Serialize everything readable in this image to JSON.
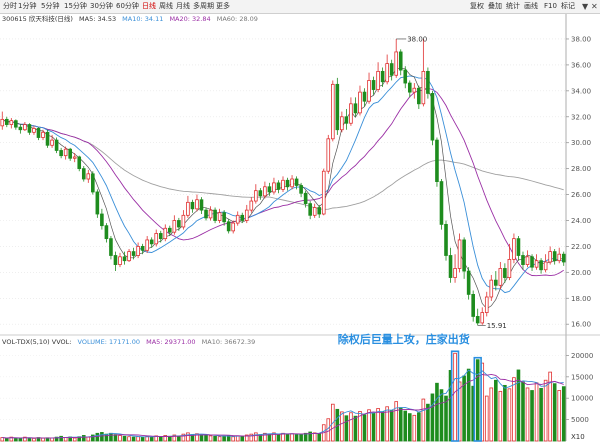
{
  "toolbar": {
    "left_items": [
      "分时",
      "1分钟",
      "5分钟",
      "15分钟",
      "30分钟",
      "60分钟",
      "日线",
      "周线",
      "月线",
      "多周期",
      "更多"
    ],
    "active_index": 6,
    "right_items": [
      "复权",
      "叠加",
      "统计",
      "画线",
      "F10",
      "标记"
    ]
  },
  "main_legend": {
    "stock": "300615 欣天科技(日线)",
    "ma5": "MA5: 34.53",
    "ma10": "MA10: 34.11",
    "ma20": "MA20: 32.84",
    "ma60": "MA60: 28.09"
  },
  "vol_legend": {
    "indicator": "VOL-TDX(5,10) VVOL:",
    "volume": "VOLUME: 17171.00",
    "ma5": "MA5: 29371.00",
    "ma10": "MA10: 36672.39"
  },
  "annotation_text": "除权后巨量上攻，庄家出货",
  "scale_badge": "X10",
  "colors": {
    "up": "#e03030",
    "down": "#1e8c1e",
    "ma5": "#3a8fd8",
    "ma10": "#9b2fa5",
    "ma20": "#7a7a7a",
    "ma60": "#a0a0a0",
    "highlight": "#2a8fe0"
  },
  "chart_data": {
    "type": "candlestick",
    "price_axis": {
      "ylim": [
        15.4,
        39.0
      ],
      "ticks": [
        16.0,
        18.0,
        20.0,
        22.0,
        24.0,
        26.0,
        28.0,
        30.0,
        32.0,
        34.0,
        36.0,
        38.0
      ]
    },
    "volume_axis": {
      "ylim": [
        0,
        21500
      ],
      "ticks": [
        5000,
        10000,
        15000,
        20000
      ]
    },
    "annotations": {
      "high": "38.00",
      "low": "15.91"
    },
    "candles": [
      [
        31.3,
        31.8,
        31.0,
        32.4
      ],
      [
        31.8,
        31.4,
        31.2,
        32.0
      ],
      [
        31.4,
        31.7,
        31.1,
        31.9
      ],
      [
        31.7,
        31.2,
        31.0,
        31.8
      ],
      [
        31.2,
        31.0,
        30.7,
        31.4
      ],
      [
        31.0,
        31.4,
        30.9,
        31.6
      ],
      [
        31.4,
        30.8,
        30.6,
        31.5
      ],
      [
        30.8,
        31.1,
        30.6,
        31.3
      ],
      [
        31.1,
        30.4,
        30.2,
        31.2
      ],
      [
        30.4,
        30.8,
        30.2,
        31.0
      ],
      [
        30.8,
        29.8,
        29.6,
        31.0
      ],
      [
        29.8,
        30.2,
        29.6,
        30.6
      ],
      [
        30.2,
        29.4,
        29.2,
        30.4
      ],
      [
        29.4,
        29.0,
        28.8,
        29.6
      ],
      [
        29.0,
        29.5,
        28.7,
        29.7
      ],
      [
        29.5,
        28.8,
        28.6,
        29.6
      ],
      [
        28.8,
        28.9,
        28.5,
        29.2
      ],
      [
        28.9,
        28.0,
        27.8,
        29.0
      ],
      [
        28.0,
        27.2,
        27.0,
        28.2
      ],
      [
        27.2,
        27.6,
        26.9,
        27.9
      ],
      [
        27.6,
        26.2,
        26.0,
        27.8
      ],
      [
        26.2,
        24.5,
        24.2,
        26.4
      ],
      [
        24.5,
        23.6,
        23.3,
        24.9
      ],
      [
        23.6,
        22.6,
        22.3,
        23.8
      ],
      [
        22.6,
        21.3,
        21.0,
        22.8
      ],
      [
        21.3,
        20.6,
        20.1,
        21.6
      ],
      [
        20.6,
        21.2,
        20.4,
        21.5
      ],
      [
        21.2,
        20.9,
        20.6,
        21.6
      ],
      [
        20.9,
        21.6,
        20.8,
        21.8
      ],
      [
        21.6,
        21.3,
        21.0,
        21.9
      ],
      [
        21.3,
        22.0,
        21.1,
        22.3
      ],
      [
        22.0,
        21.7,
        21.4,
        22.2
      ],
      [
        21.7,
        22.5,
        21.5,
        22.8
      ],
      [
        22.5,
        22.2,
        21.9,
        22.7
      ],
      [
        22.2,
        23.0,
        22.0,
        23.3
      ],
      [
        23.0,
        22.6,
        22.3,
        23.2
      ],
      [
        22.6,
        23.4,
        22.4,
        23.7
      ],
      [
        23.4,
        23.1,
        22.8,
        23.6
      ],
      [
        23.1,
        24.0,
        22.9,
        24.4
      ],
      [
        24.0,
        23.5,
        23.2,
        24.2
      ],
      [
        23.5,
        24.4,
        23.3,
        24.8
      ],
      [
        24.4,
        25.4,
        24.2,
        25.9
      ],
      [
        25.4,
        24.9,
        24.6,
        25.6
      ],
      [
        24.9,
        25.6,
        24.7,
        26.0
      ],
      [
        25.6,
        24.8,
        24.5,
        25.8
      ],
      [
        24.8,
        24.2,
        24.0,
        25.0
      ],
      [
        24.2,
        24.8,
        24.0,
        25.1
      ],
      [
        24.8,
        24.0,
        23.8,
        25.0
      ],
      [
        24.0,
        24.6,
        23.8,
        24.9
      ],
      [
        24.6,
        23.9,
        23.6,
        24.8
      ],
      [
        23.9,
        23.2,
        23.0,
        24.1
      ],
      [
        23.2,
        23.8,
        23.0,
        24.0
      ],
      [
        23.8,
        24.4,
        23.6,
        24.7
      ],
      [
        24.4,
        24.0,
        23.8,
        24.6
      ],
      [
        24.0,
        24.8,
        23.8,
        25.2
      ],
      [
        24.8,
        25.5,
        24.6,
        25.8
      ],
      [
        25.5,
        26.3,
        25.3,
        26.8
      ],
      [
        26.3,
        25.9,
        25.6,
        26.5
      ],
      [
        25.9,
        26.6,
        25.7,
        27.0
      ],
      [
        26.6,
        26.2,
        25.9,
        26.9
      ],
      [
        26.2,
        26.9,
        26.0,
        27.3
      ],
      [
        26.9,
        26.4,
        26.1,
        27.1
      ],
      [
        26.4,
        27.1,
        26.2,
        27.4
      ],
      [
        27.1,
        26.6,
        26.3,
        27.3
      ],
      [
        26.6,
        27.2,
        26.4,
        27.5
      ],
      [
        27.2,
        26.7,
        26.4,
        27.4
      ],
      [
        26.7,
        26.1,
        25.8,
        26.9
      ],
      [
        26.1,
        25.3,
        25.0,
        26.3
      ],
      [
        25.3,
        24.4,
        24.1,
        25.5
      ],
      [
        24.4,
        25.0,
        24.2,
        25.3
      ],
      [
        25.0,
        24.5,
        24.2,
        25.2
      ],
      [
        24.5,
        27.8,
        24.4,
        28.0
      ],
      [
        27.8,
        30.3,
        27.6,
        30.6
      ],
      [
        30.3,
        34.5,
        30.1,
        34.8
      ],
      [
        34.5,
        31.0,
        30.6,
        35.0
      ],
      [
        31.0,
        32.0,
        30.8,
        32.4
      ],
      [
        32.0,
        31.5,
        31.0,
        32.6
      ],
      [
        31.5,
        33.0,
        31.3,
        33.5
      ],
      [
        33.0,
        32.3,
        32.0,
        33.5
      ],
      [
        32.3,
        33.9,
        32.1,
        34.4
      ],
      [
        33.9,
        33.2,
        32.8,
        34.2
      ],
      [
        33.2,
        34.8,
        33.0,
        35.4
      ],
      [
        34.8,
        34.1,
        33.7,
        35.1
      ],
      [
        34.1,
        35.5,
        33.9,
        36.2
      ],
      [
        35.5,
        34.7,
        34.3,
        35.8
      ],
      [
        34.7,
        36.1,
        34.5,
        36.8
      ],
      [
        36.1,
        35.2,
        34.8,
        36.4
      ],
      [
        35.2,
        37.0,
        35.0,
        38.0
      ],
      [
        37.0,
        35.6,
        35.2,
        37.2
      ],
      [
        35.6,
        34.6,
        34.2,
        35.9
      ],
      [
        34.6,
        33.9,
        33.5,
        34.8
      ],
      [
        33.9,
        34.2,
        33.4,
        34.6
      ],
      [
        34.2,
        33.0,
        32.6,
        34.4
      ],
      [
        33.0,
        35.5,
        32.8,
        38.0
      ],
      [
        35.5,
        33.8,
        33.4,
        35.8
      ],
      [
        33.8,
        30.2,
        29.8,
        34.0
      ],
      [
        30.2,
        27.0,
        26.6,
        30.4
      ],
      [
        27.0,
        23.7,
        23.3,
        27.2
      ],
      [
        23.7,
        21.3,
        20.9,
        24.0
      ],
      [
        21.3,
        19.6,
        19.2,
        21.9
      ],
      [
        19.6,
        20.3,
        19.2,
        21.4
      ],
      [
        20.3,
        22.5,
        20.0,
        23.0
      ],
      [
        22.5,
        20.1,
        19.5,
        22.7
      ],
      [
        20.1,
        18.3,
        17.9,
        20.4
      ],
      [
        18.3,
        16.6,
        16.2,
        18.6
      ],
      [
        16.6,
        16.1,
        15.91,
        17.2
      ],
      [
        16.1,
        16.9,
        15.95,
        17.3
      ],
      [
        16.9,
        18.1,
        16.6,
        18.5
      ],
      [
        18.1,
        19.4,
        17.8,
        19.8
      ],
      [
        19.4,
        19.0,
        18.6,
        20.1
      ],
      [
        19.0,
        20.3,
        18.7,
        20.8
      ],
      [
        20.3,
        19.6,
        19.2,
        20.7
      ],
      [
        19.6,
        21.0,
        19.4,
        22.2
      ],
      [
        21.0,
        22.6,
        20.7,
        23.0
      ],
      [
        22.6,
        21.3,
        20.9,
        22.8
      ],
      [
        21.3,
        20.6,
        20.2,
        21.6
      ],
      [
        20.6,
        21.2,
        20.4,
        21.7
      ],
      [
        21.2,
        20.4,
        20.1,
        21.4
      ],
      [
        20.4,
        20.9,
        20.2,
        21.4
      ],
      [
        20.9,
        20.2,
        19.9,
        21.1
      ],
      [
        20.2,
        20.8,
        20.0,
        21.4
      ],
      [
        20.8,
        21.6,
        20.6,
        22.0
      ],
      [
        21.6,
        20.9,
        20.6,
        21.8
      ],
      [
        20.9,
        21.4,
        20.7,
        21.9
      ],
      [
        21.4,
        20.8,
        20.5,
        21.6
      ]
    ],
    "volume": [
      800,
      600,
      900,
      700,
      650,
      900,
      700,
      600,
      800,
      650,
      750,
      700,
      900,
      1100,
      800,
      950,
      700,
      1000,
      1300,
      900,
      1400,
      1800,
      2000,
      1600,
      1800,
      1500,
      1300,
      1100,
      1000,
      900,
      1000,
      900,
      1100,
      950,
      1200,
      1000,
      1300,
      1100,
      1400,
      1200,
      1600,
      1900,
      1500,
      1700,
      1400,
      1300,
      1200,
      1100,
      1000,
      1100,
      1300,
      1000,
      1200,
      1100,
      1400,
      1600,
      1900,
      1500,
      1800,
      1600,
      1900,
      1500,
      1800,
      1600,
      1700,
      1500,
      1600,
      1800,
      2100,
      1900,
      1700,
      3800,
      5200,
      8600,
      7400,
      6800,
      5900,
      6600,
      5800,
      6900,
      6100,
      7300,
      6500,
      7600,
      6800,
      8000,
      7100,
      9200,
      7800,
      7000,
      6400,
      6000,
      6600,
      9800,
      8600,
      11000,
      13500,
      12000,
      10500,
      16500,
      20500,
      13800,
      15200,
      16800,
      12800,
      19000,
      18200,
      10500,
      12400,
      14200,
      11600,
      13000,
      12200,
      14800,
      16600,
      13800,
      12400,
      11800,
      13600,
      12300,
      14200,
      16100,
      13400,
      11800,
      12700
    ]
  }
}
